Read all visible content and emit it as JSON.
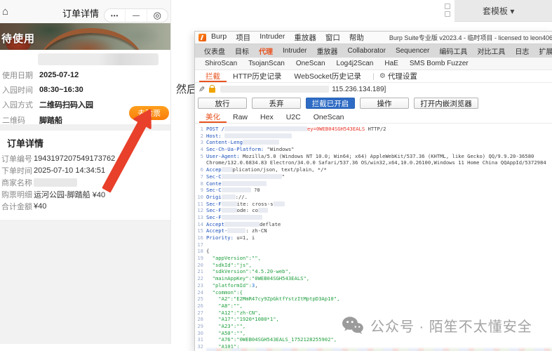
{
  "colors": {
    "accent_orange": "#f97d0b",
    "burp_orange": "#e8531f",
    "primary_blue": "#2e6bc4",
    "arrow_red": "#e8402a",
    "json_green": "#1f9e3d",
    "header_blue": "#1a4fba",
    "highlight_red": "#e8352b"
  },
  "phone": {
    "nav_title": "订单详情",
    "capsule": [
      {
        "glyph": "•••",
        "kind": "dots"
      },
      {
        "glyph": "—",
        "kind": "min"
      },
      {
        "glyph": "◎",
        "kind": "target"
      }
    ],
    "status_banner": "待使用",
    "info_rows": [
      {
        "label": "使用日期",
        "value": "2025-07-12"
      },
      {
        "label": "入园时间",
        "value": "08:30~16:30"
      },
      {
        "label": "入园方式",
        "value": "二维码扫码入园"
      },
      {
        "label": "二维码",
        "value": "脚踏船"
      }
    ],
    "check_button": "去验票",
    "order_card": {
      "title": "订单详情",
      "rows": [
        {
          "label": "订单编号",
          "value": "1943197207549173762"
        },
        {
          "label": "下单时间",
          "value": "2025-07-10 14:34:51"
        },
        {
          "label": "商家名称",
          "value": "",
          "redacted": true
        },
        {
          "label": "购票明细",
          "value": "运河公园-脚踏船  ¥40"
        },
        {
          "label": "合计金额",
          "value": "¥40"
        }
      ]
    }
  },
  "article": {
    "partial_text": "然后",
    "template_button": "套模板 ▾"
  },
  "burp": {
    "menu": [
      "Burp",
      "项目",
      "Intruder",
      "重放器",
      "窗口",
      "帮助"
    ],
    "title": "Burp Suite专业版  v2023.4 - 临时项目 - licensed to leon406",
    "main_tabs": [
      {
        "label": "仪表盘"
      },
      {
        "label": "目标"
      },
      {
        "label": "代理",
        "active": true
      },
      {
        "label": "Intruder"
      },
      {
        "label": "重放器"
      },
      {
        "label": "Collaborator"
      },
      {
        "label": "Sequencer"
      },
      {
        "label": "编码工具"
      },
      {
        "label": "对比工具"
      },
      {
        "label": "日志"
      },
      {
        "label": "扩展"
      }
    ],
    "ext_tabs": [
      "ShiroScan",
      "TsojanScan",
      "OneScan",
      "Log4j2Scan",
      "HaE",
      "SMS Bomb Fuzzer"
    ],
    "proxy_tabs": [
      {
        "label": "拦截",
        "active": true
      },
      {
        "label": "HTTP历史记录"
      },
      {
        "label": "WebSocket历史记录"
      }
    ],
    "proxy_settings_label": "代理设置",
    "intercept_bar": {
      "host_suffix": "115.236.134.189]"
    },
    "buttons": [
      {
        "label": "放行"
      },
      {
        "label": "丢弃"
      },
      {
        "label": "拦截已开启",
        "primary": true
      },
      {
        "label": "操作"
      },
      {
        "label": "打开内嵌浏览器",
        "wide": true
      }
    ],
    "editor_tabs": [
      {
        "label": "美化",
        "active": true
      },
      {
        "label": "Raw"
      },
      {
        "label": "Hex"
      },
      {
        "label": "U2C"
      },
      {
        "label": "OneScan"
      }
    ],
    "request_lines": [
      {
        "n": "1",
        "seg": [
          {
            "t": "POST /",
            "c": "h"
          },
          {
            "b": 118
          },
          {
            "t": "ey=0WEB04SGH543EALS",
            "c": "r"
          },
          {
            "t": " HTTP/2",
            "c": "v"
          }
        ]
      },
      {
        "n": "2",
        "seg": [
          {
            "t": "Host: ",
            "c": "h"
          },
          {
            "b": 96
          }
        ]
      },
      {
        "n": "3",
        "seg": [
          {
            "t": "Content-Leng",
            "c": "h"
          },
          {
            "b": 52
          }
        ]
      },
      {
        "n": "4",
        "seg": [
          {
            "t": "Sec-Ch-Ua-Platform: ",
            "c": "h"
          },
          {
            "t": "\"Windows\"",
            "c": "v"
          }
        ]
      },
      {
        "n": "5",
        "seg": [
          {
            "t": "User-Agent: ",
            "c": "h"
          },
          {
            "t": "Mozilla/5.0 (Windows NT 10.0; Win64; x64) AppleWebKit/537.36 (KHTML, like Gecko) QQ/9.9.20-36580",
            "c": "v"
          }
        ]
      },
      {
        "n": "",
        "seg": [
          {
            "t": "Chrome/132.0.6834.83 Electron/34.0.0 Safari/537.36 OS/win32,x64,10.0.26100,Windows 11 Home China QQAppId/5372984",
            "c": "v"
          }
        ]
      },
      {
        "n": "6",
        "seg": [
          {
            "t": "Accep",
            "c": "h"
          },
          {
            "b": 16
          },
          {
            "t": "plication/json, text/plain, */*",
            "c": "v"
          }
        ]
      },
      {
        "n": "7",
        "seg": [
          {
            "t": "Sec-C",
            "c": "h"
          },
          {
            "b": 86
          },
          {
            "t": "\"",
            "c": "v"
          }
        ]
      },
      {
        "n": "8",
        "seg": [
          {
            "t": "Conte",
            "c": "h"
          },
          {
            "b": 64
          }
        ]
      },
      {
        "n": "9",
        "seg": [
          {
            "t": "Sec-C",
            "c": "h"
          },
          {
            "b": 42
          },
          {
            "t": " ?0",
            "c": "v"
          }
        ]
      },
      {
        "n": "10",
        "seg": [
          {
            "t": "Origi",
            "c": "h"
          },
          {
            "b": 20
          },
          {
            "t": "://.",
            "c": "v"
          }
        ]
      },
      {
        "n": "11",
        "seg": [
          {
            "t": "Sec-F",
            "c": "h"
          },
          {
            "b": 22
          },
          {
            "t": "ite: cross-s",
            "c": "v"
          },
          {
            "b": 16
          }
        ]
      },
      {
        "n": "12",
        "seg": [
          {
            "t": "Sec-F",
            "c": "h"
          },
          {
            "b": 22
          },
          {
            "t": "ode: co",
            "c": "v"
          },
          {
            "b": 14
          }
        ]
      },
      {
        "n": "13",
        "seg": [
          {
            "t": "Sec-F",
            "c": "h"
          },
          {
            "b": 58
          }
        ]
      },
      {
        "n": "14",
        "seg": [
          {
            "t": "Accept",
            "c": "h"
          },
          {
            "b": 50
          },
          {
            "t": "deflate",
            "c": "v"
          }
        ]
      },
      {
        "n": "15",
        "seg": [
          {
            "t": "Accept-",
            "c": "h"
          },
          {
            "b": 26
          },
          {
            "t": ": zh-CN",
            "c": "v"
          }
        ]
      },
      {
        "n": "16",
        "seg": [
          {
            "t": "Priority: ",
            "c": "h"
          },
          {
            "t": "u=1, i",
            "c": "v"
          }
        ]
      },
      {
        "n": "17",
        "seg": []
      },
      {
        "n": "18",
        "seg": [
          {
            "t": "{",
            "c": "v"
          }
        ]
      },
      {
        "n": "19",
        "seg": [
          {
            "t": "  \"appVersion\":\"\",",
            "c": "g"
          }
        ]
      },
      {
        "n": "20",
        "seg": [
          {
            "t": "  \"sdkId\":\"js\",",
            "c": "g"
          }
        ]
      },
      {
        "n": "21",
        "seg": [
          {
            "t": "  \"sdkVersion\":\"4.5.20-web\",",
            "c": "g"
          }
        ]
      },
      {
        "n": "22",
        "seg": [
          {
            "t": "  \"mainAppKey\":\"0WEB04SGH543EALS\",",
            "c": "g"
          }
        ]
      },
      {
        "n": "23",
        "seg": [
          {
            "t": "  \"platformId\":",
            "c": "g"
          },
          {
            "t": "3",
            "c": "nm"
          },
          {
            "t": ",",
            "c": "v"
          }
        ]
      },
      {
        "n": "24",
        "seg": [
          {
            "t": "  \"common\":{",
            "c": "g"
          }
        ]
      },
      {
        "n": "25",
        "seg": [
          {
            "t": "    \"A2\":\"E2MmR47cy9ZpGktfYstzItMptpD3Ap10\",",
            "c": "g"
          }
        ]
      },
      {
        "n": "26",
        "seg": [
          {
            "t": "    \"A8\":\"\",",
            "c": "g"
          }
        ]
      },
      {
        "n": "27",
        "seg": [
          {
            "t": "    \"A12\":\"zh-CN\",",
            "c": "g"
          }
        ]
      },
      {
        "n": "28",
        "seg": [
          {
            "t": "    \"A17\":\"1920*1080*1\",",
            "c": "g"
          }
        ]
      },
      {
        "n": "29",
        "seg": [
          {
            "t": "    \"A23\":\"\",",
            "c": "g"
          }
        ]
      },
      {
        "n": "30",
        "seg": [
          {
            "t": "    \"A50\":\"\",",
            "c": "g"
          }
        ]
      },
      {
        "n": "31",
        "seg": [
          {
            "t": "    \"A76\":\"0WEB04SGH543EALS_1752128255902\",",
            "c": "g"
          }
        ]
      },
      {
        "n": "32",
        "seg": [
          {
            "t": "    \"A101\":",
            "c": "g"
          }
        ]
      }
    ]
  },
  "watermark": {
    "text": "公众号 · 陌笙不太懂安全"
  }
}
